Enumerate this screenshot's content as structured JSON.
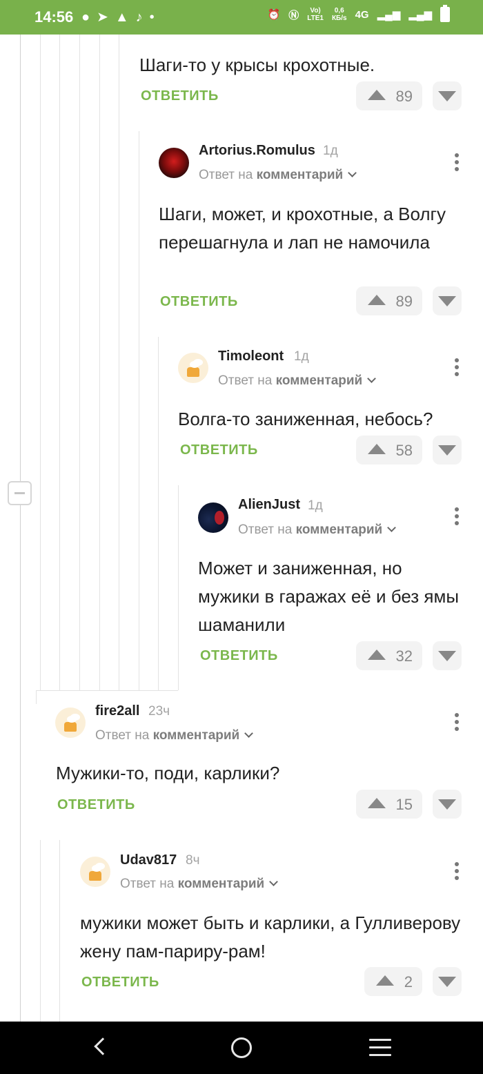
{
  "status_bar": {
    "time": "14:56",
    "left_icons": [
      "chat-icon",
      "telegram-icon",
      "warning-icon",
      "tiktok-icon",
      "dot-icon"
    ],
    "volte_top": "Vo)",
    "volte_bottom": "LTE1",
    "speed_top": "0,6",
    "speed_bottom": "КБ/s",
    "network": "4G",
    "accent_color": "#79b14b"
  },
  "ui": {
    "reply_label": "ОТВЕТИТЬ",
    "reply_to_prefix": "Ответ на",
    "reply_to_link": "комментарий",
    "reply_color": "#7bb74c"
  },
  "comments": [
    {
      "text": "Шаги-то у крысы крохотные.",
      "votes": "89"
    },
    {
      "author": "Artorius.Romulus",
      "time": "1д",
      "text": "Шаги, может, и крохотные, а Волгу перешагнула и лап не намочила",
      "votes": "89"
    },
    {
      "author": "Timoleont",
      "time": "1д",
      "text": "Волга-то заниженная, небось?",
      "votes": "58"
    },
    {
      "author": "AlienJust",
      "time": "1д",
      "text": "Может и заниженная, но мужики в гаражах её и без ямы шаманили",
      "votes": "32"
    },
    {
      "author": "fire2all",
      "time": "23ч",
      "text": "Мужики-то, поди, карлики?",
      "votes": "15"
    },
    {
      "author": "Udav817",
      "time": "8ч",
      "text": "мужики может быть и карлики, а Гулливерову жену пам-париру-рам!",
      "votes": "2"
    }
  ]
}
